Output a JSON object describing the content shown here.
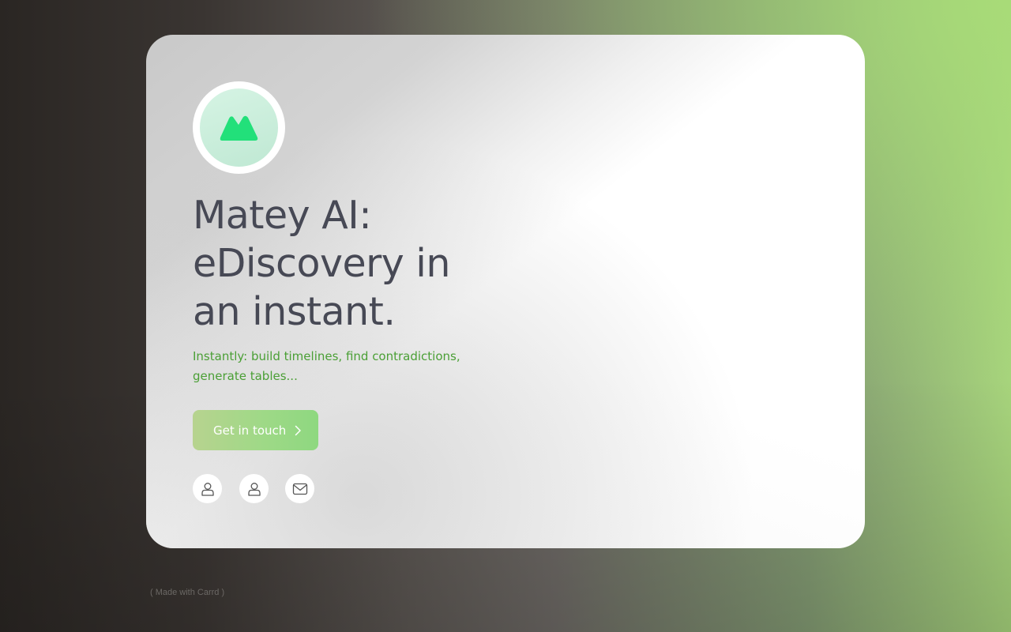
{
  "hero": {
    "logo_icon": "mountain-icon",
    "title": "Matey AI: eDiscovery in an instant.",
    "subtitle": "Instantly: build timelines, find contradictions, generate tables...",
    "cta_label": "Get in touch",
    "cta_icon": "chevron-right-icon"
  },
  "social_links": [
    {
      "icon": "user-icon"
    },
    {
      "icon": "user-icon"
    },
    {
      "icon": "mail-icon"
    }
  ],
  "footer": {
    "label": "( Made with Carrd )"
  },
  "colors": {
    "accent_green": "#4a9f35",
    "logo_green": "#22e07a",
    "title_color": "#474955"
  }
}
